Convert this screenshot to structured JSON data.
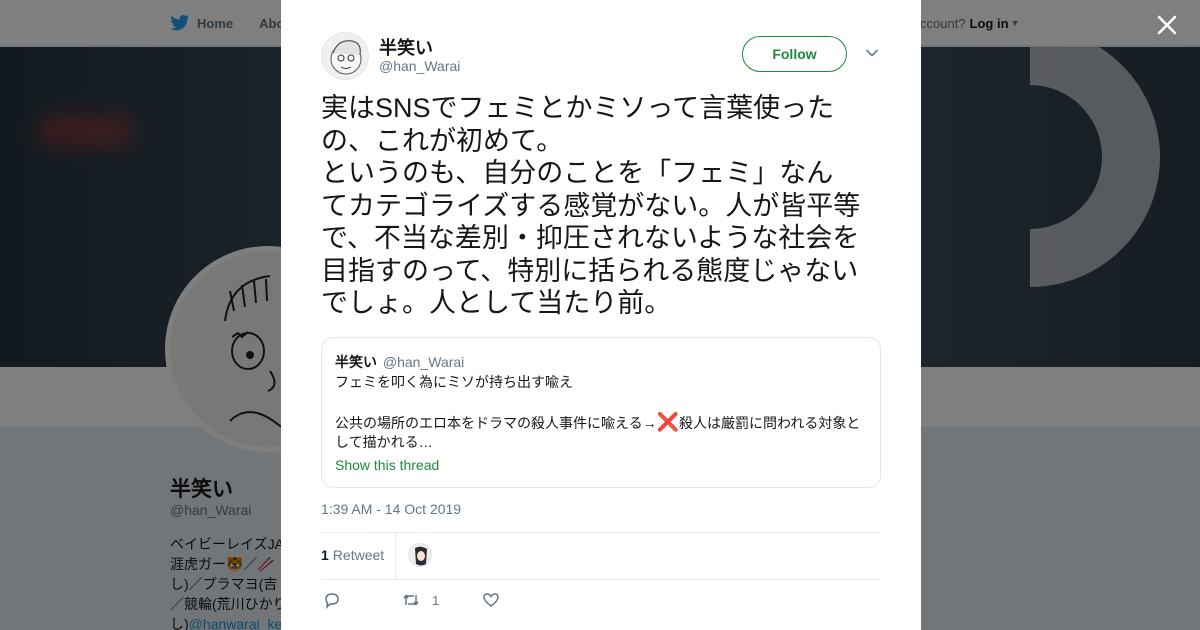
{
  "background": {
    "nav": {
      "home_label": "Home",
      "about_label": "Abo"
    },
    "login": {
      "prompt": "ccount?",
      "link": "Log in"
    },
    "profile": {
      "name": "半笑い",
      "handle": "@han_Warai",
      "bio_lines": [
        "ベイビーレイズJA",
        "涯虎ガー🐯／🥢",
        "し)／プラマヨ(吉",
        "／競輪(荒川ひかり",
        "し)"
      ],
      "bio_link": "@hanwarai_ke"
    }
  },
  "tweet": {
    "author_name": "半笑い",
    "author_handle": "@han_Warai",
    "follow_label": "Follow",
    "text": "実はSNSでフェミとかミソって言葉使った\nの、これが初めて。\nというのも、自分のことを「フェミ」なん\nてカテゴライズする感覚がない。人が皆平等\nで、不当な差別・抑圧されないような社会を\n目指すのって、特別に括られる態度じゃない\nでしょ。人として当たり前。",
    "quote": {
      "name": "半笑い",
      "handle": "@han_Warai",
      "line1": "フェミを叩く為にミソが持ち出す喩え",
      "line2_before": "公共の場所のエロ本をドラマの殺人事件に喩える→",
      "line2_mark": "❌",
      "line2_after": "殺人は厳罰に問われる対象と",
      "line3": "して描かれる…",
      "show_thread": "Show this thread"
    },
    "timestamp": "1:39 AM - 14 Oct 2019",
    "retweet_count": "1",
    "retweet_label": "Retweet",
    "action_retweet_count": "1"
  },
  "colors": {
    "accent_green": "#1b8a3d",
    "text_primary": "#14171a",
    "text_secondary": "#657786",
    "twitter_blue": "#1da1f2",
    "xmark_red": "#dd2e44"
  },
  "icons": {
    "logo": "twitter-bird-icon",
    "close": "close-icon",
    "chevron": "chevron-down-icon",
    "reply": "reply-icon",
    "retweet": "retweet-icon",
    "like": "heart-icon"
  }
}
